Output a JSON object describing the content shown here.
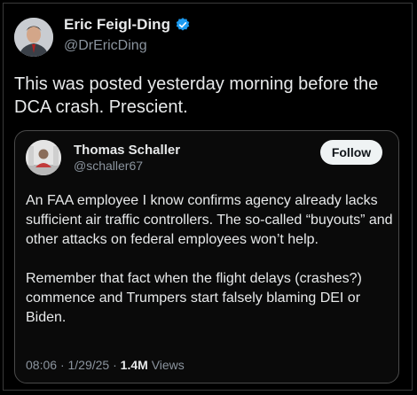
{
  "author": {
    "name": "Eric Feigl-Ding",
    "handle": "@DrEricDing",
    "verified_badge_color": "#1d9bf0"
  },
  "tweet": {
    "text": "This was posted yesterday morning before the DCA crash. Prescient."
  },
  "quoted_tweet": {
    "author_name": "Thomas Schaller",
    "author_handle": "@schaller67",
    "follow_label": "Follow",
    "paragraphs": [
      "An FAA employee I know confirms agency already lacks sufficient air traffic controllers. The so-called “buyouts” and other attacks on federal employees won’t help.",
      "Remember that fact when the flight delays (crashes?) commence and Trumpers start falsely blaming DEI or Biden."
    ],
    "time": "08:06",
    "date": "1/29/25",
    "separator": "·",
    "views_count": "1.4M",
    "views_label": "Views"
  },
  "colors": {
    "background": "#000000",
    "text_primary": "#e7e9ea",
    "text_secondary": "#8b949e",
    "follow_button_bg": "#eff3f4"
  }
}
